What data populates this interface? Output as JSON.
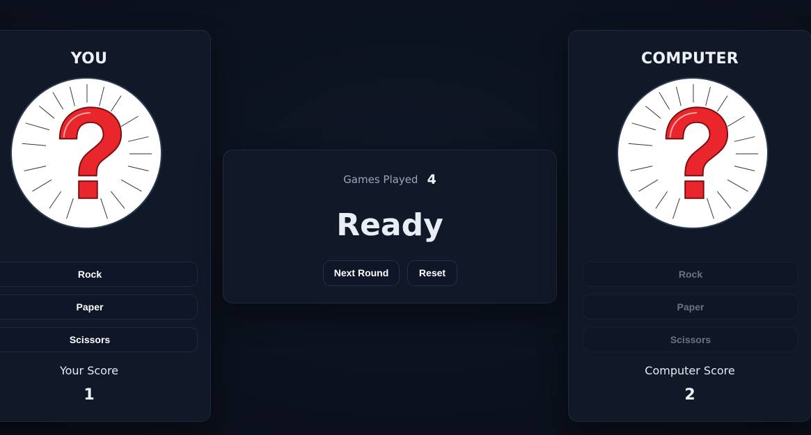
{
  "player": {
    "title": "YOU",
    "choices": [
      "Rock",
      "Paper",
      "Scissors"
    ],
    "score_label": "Your Score",
    "score": "1",
    "avatar_icon": "question-mark-icon"
  },
  "computer": {
    "title": "COMPUTER",
    "choices": [
      "Rock",
      "Paper",
      "Scissors"
    ],
    "score_label": "Computer Score",
    "score": "2",
    "avatar_icon": "question-mark-icon",
    "choices_disabled": true
  },
  "center": {
    "games_label": "Games Played",
    "games_count": "4",
    "status": "Ready",
    "next_label": "Next Round",
    "reset_label": "Reset"
  },
  "colors": {
    "background": "#0b111d",
    "card": "#111827",
    "accent_red": "#e8262b"
  }
}
